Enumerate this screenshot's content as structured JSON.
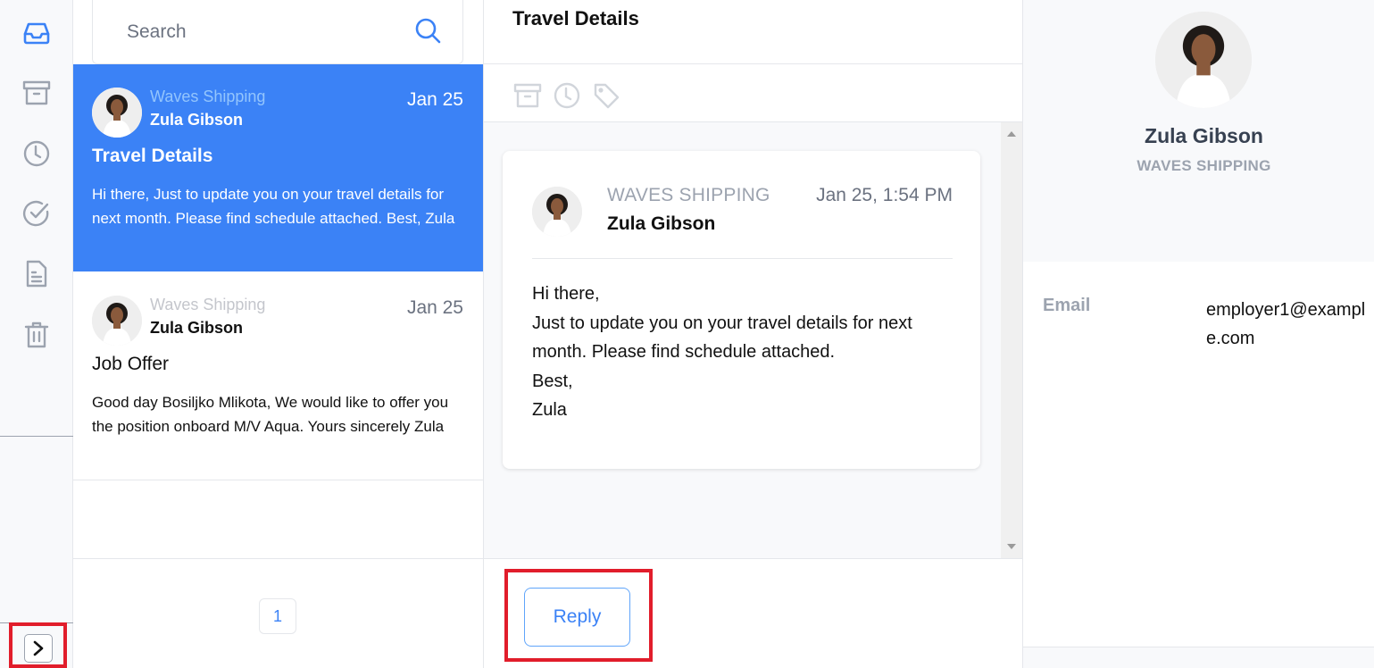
{
  "sidebar": {
    "items": [
      {
        "icon": "inbox-icon",
        "label": "Inbox",
        "active": true
      },
      {
        "icon": "archive-icon",
        "label": "Archive",
        "active": false
      },
      {
        "icon": "clock-icon",
        "label": "Snoozed",
        "active": false
      },
      {
        "icon": "check-circle-icon",
        "label": "Done",
        "active": false
      },
      {
        "icon": "document-icon",
        "label": "Drafts",
        "active": false
      },
      {
        "icon": "trash-icon",
        "label": "Trash",
        "active": false
      }
    ],
    "expand_icon": "chevron-right-icon"
  },
  "search": {
    "placeholder": "Search",
    "value": ""
  },
  "messages": [
    {
      "company": "Waves Shipping",
      "sender": "Zula Gibson",
      "date": "Jan 25",
      "subject": "Travel Details",
      "preview": "Hi there, Just to update you on your travel details for next month. Please find schedule attached. Best, Zula",
      "active": true
    },
    {
      "company": "Waves Shipping",
      "sender": "Zula Gibson",
      "date": "Jan 25",
      "subject": "Job Offer",
      "preview": "Good day Bosiljko Mlikota, We would like to offer you the position onboard M/V Aqua. Yours sincerely Zula",
      "active": false
    }
  ],
  "pagination": {
    "current_page": "1"
  },
  "reading_pane": {
    "title": "Travel Details",
    "toolbar": [
      "archive-icon",
      "clock-icon",
      "tag-icon"
    ],
    "email": {
      "company": "WAVES SHIPPING",
      "sender": "Zula Gibson",
      "datetime": "Jan 25, 1:54 PM",
      "body_lines": [
        "Hi there,",
        "Just to update you on your travel details for next month. Please find schedule attached.",
        "Best,",
        "Zula"
      ]
    },
    "reply_label": "Reply"
  },
  "contact": {
    "name": "Zula Gibson",
    "company": "WAVES SHIPPING",
    "email_label": "Email",
    "email_value": "employer1@example.com"
  },
  "colors": {
    "accent": "#3b82f6",
    "highlight": "#e11d2b",
    "muted": "#9ca3af"
  }
}
